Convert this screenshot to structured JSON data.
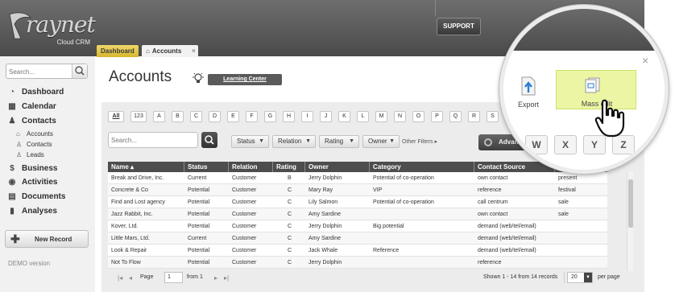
{
  "brand": {
    "name": "raynet",
    "sub": "Cloud CRM"
  },
  "header": {
    "support_label": "SUPPORT"
  },
  "tabs": [
    {
      "label": "Dashboard"
    },
    {
      "label": "Accounts",
      "close": "×"
    }
  ],
  "sidebar": {
    "search_placeholder": "Search...",
    "items": [
      {
        "label": "Dashboard",
        "icon": "dashboard-icon"
      },
      {
        "label": "Calendar",
        "icon": "calendar-icon"
      },
      {
        "label": "Contacts",
        "icon": "contacts-icon"
      },
      {
        "label": "Business",
        "icon": "business-icon"
      },
      {
        "label": "Activities",
        "icon": "activities-icon"
      },
      {
        "label": "Documents",
        "icon": "documents-icon"
      },
      {
        "label": "Analyses",
        "icon": "analyses-icon"
      }
    ],
    "sub_items": [
      {
        "label": "Accounts",
        "icon": "home-icon"
      },
      {
        "label": "Contacts",
        "icon": "person-icon"
      },
      {
        "label": "Leads",
        "icon": "leads-icon"
      }
    ],
    "new_record": "New Record",
    "demo": "DEMO version"
  },
  "main": {
    "title": "Accounts",
    "learning_center": "Learning Center",
    "letters": [
      "All",
      "123",
      "A",
      "B",
      "C",
      "D",
      "E",
      "F",
      "G",
      "H",
      "I",
      "J",
      "K",
      "L",
      "M",
      "N",
      "O",
      "P",
      "Q",
      "R",
      "S",
      "T"
    ],
    "search_placeholder": "Search...",
    "filters": [
      "Status",
      "Relation",
      "Rating",
      "Owner"
    ],
    "other_filters": "Other Filters",
    "advanced": "Advanced"
  },
  "table": {
    "columns": [
      "Name ▴",
      "Status",
      "Relation",
      "Rating",
      "Owner",
      "Category",
      "Contact Source",
      "Tags"
    ],
    "rows": [
      [
        "Break and Drive, Inc.",
        "Current",
        "Customer",
        "B",
        "Jerry Dolphin",
        "Potential of co-operation",
        "own contact",
        "present"
      ],
      [
        "Concrete & Co",
        "Potential",
        "Customer",
        "C",
        "Mary Ray",
        "VIP",
        "reference",
        "festival"
      ],
      [
        "Find and Lost agency",
        "Potential",
        "Customer",
        "C",
        "Lily Salmon",
        "Potential of co-operation",
        "call centrum",
        "sale"
      ],
      [
        "Jazz Rabbit, Inc.",
        "Potential",
        "Customer",
        "C",
        "Amy Sardine",
        "",
        "own contact",
        "sale"
      ],
      [
        "Kover, Ltd.",
        "Potential",
        "Customer",
        "C",
        "Jerry Dolphin",
        "Big potential",
        "demand (web/tel/email)",
        ""
      ],
      [
        "Little Mars, Ltd.",
        "Current",
        "Customer",
        "C",
        "Amy Sardine",
        "",
        "demand (web/tel/email)",
        ""
      ],
      [
        "Look & Repair",
        "Potential",
        "Customer",
        "C",
        "Jack Whale",
        "Reference",
        "demand (web/tel/email)",
        ""
      ],
      [
        "Not To Flow",
        "Potential",
        "Customer",
        "C",
        "Jerry Dolphin",
        "",
        "reference",
        ""
      ]
    ]
  },
  "pager": {
    "page_label": "Page",
    "page_value": "1",
    "from_label": "from 1",
    "summary": "Shown 1 - 14 from 14 records",
    "per_page_value": "20",
    "per_page_label": "per page"
  },
  "zoom": {
    "close": "×",
    "export_label": "Export",
    "mass_edit_label": "Mass edit",
    "letters": [
      "W",
      "X",
      "Y",
      "Z"
    ]
  },
  "colors": {
    "accent_tab": "#d7b72e",
    "mass_edit_bg": "#ecf5a4",
    "header_dark": "#4d4d4d"
  }
}
